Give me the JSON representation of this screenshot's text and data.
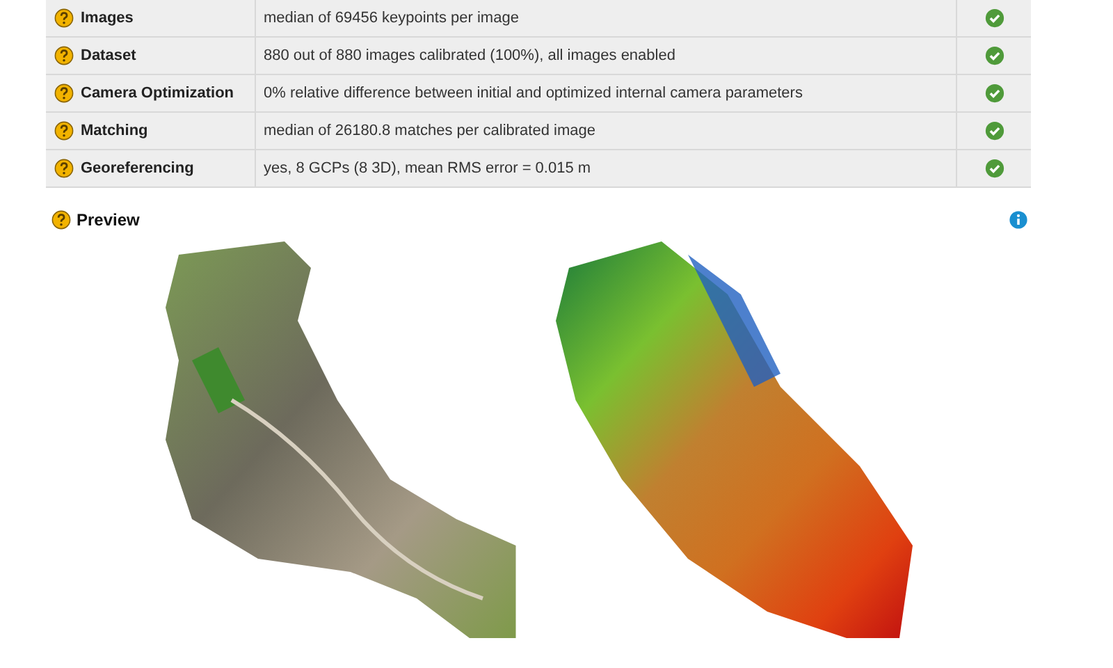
{
  "quality_check": {
    "rows": [
      {
        "label": "Images",
        "value": "median of 69456 keypoints per image",
        "ok": true
      },
      {
        "label": "Dataset",
        "value": "880 out of 880 images calibrated (100%), all images enabled",
        "ok": true
      },
      {
        "label": "Camera Optimization",
        "value": "0% relative difference between initial and optimized internal camera parameters",
        "ok": true
      },
      {
        "label": "Matching",
        "value": "median of 26180.8 matches per calibrated image",
        "ok": true
      },
      {
        "label": "Georeferencing",
        "value": "yes, 8 GCPs (8 3D), mean RMS error = 0.015 m",
        "ok": true
      }
    ]
  },
  "preview": {
    "title": "Preview"
  }
}
